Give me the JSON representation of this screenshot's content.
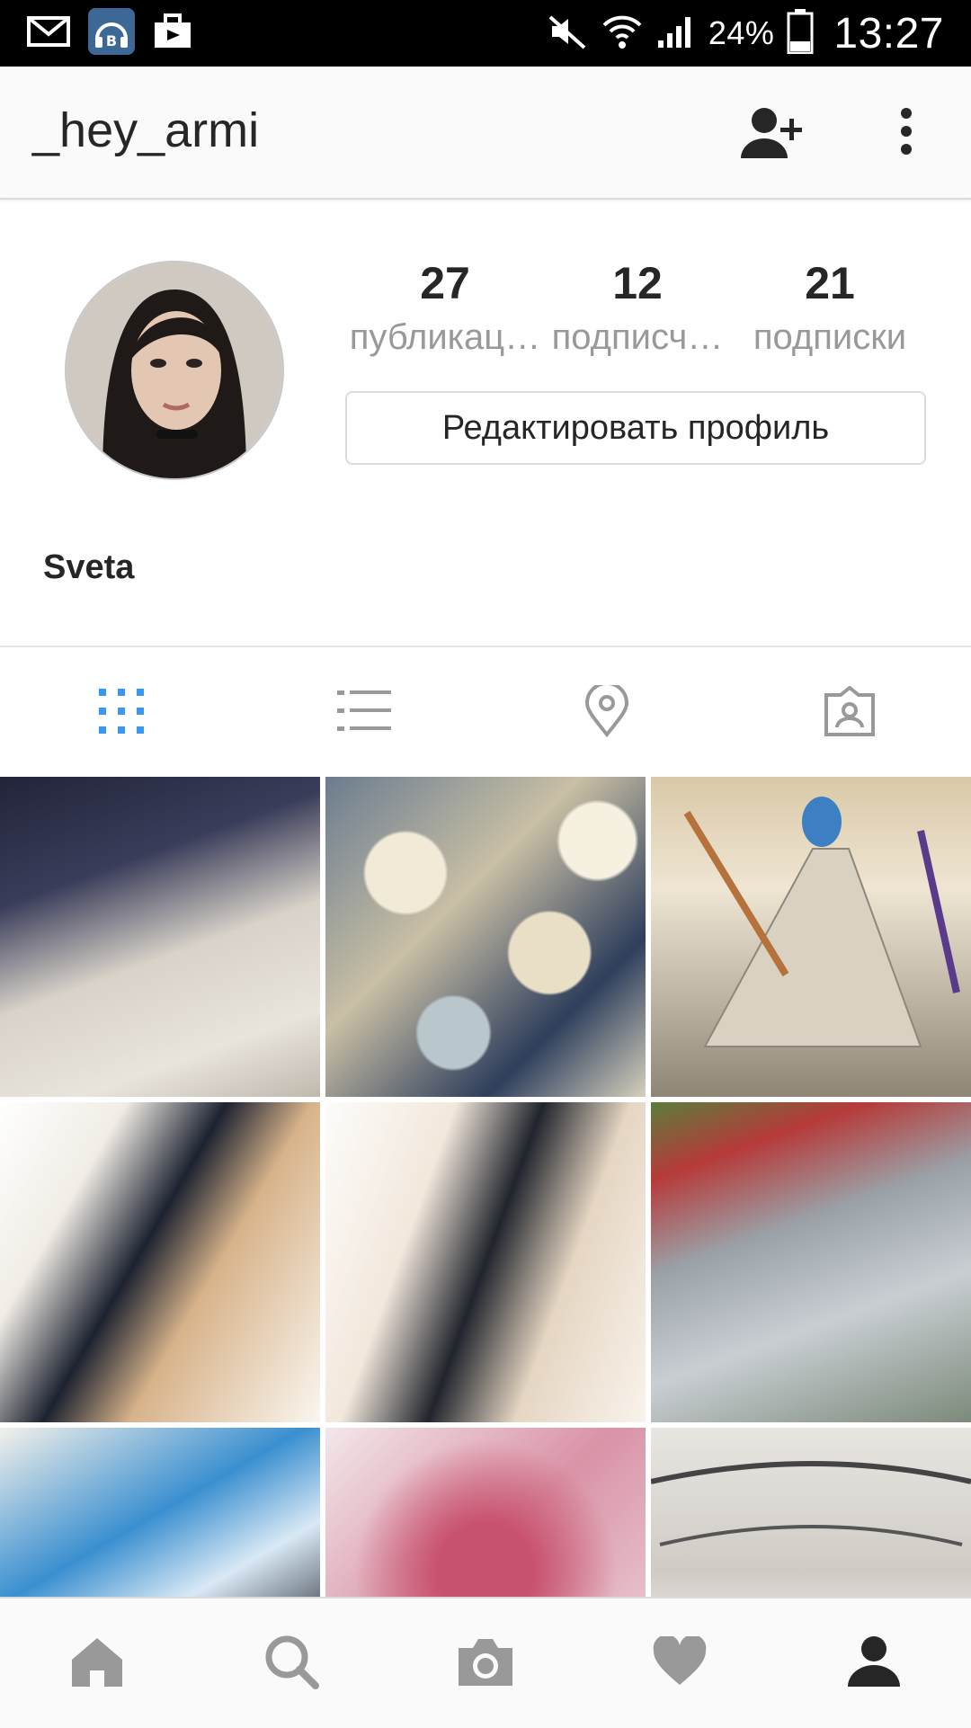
{
  "status_bar": {
    "battery_percent": "24%",
    "clock": "13:27",
    "icons": [
      "mail-icon",
      "vk-music-icon",
      "briefcase-icon",
      "mute-icon",
      "wifi-icon",
      "signal-icon",
      "battery-icon"
    ]
  },
  "header": {
    "username": "_hey_armi",
    "icons": [
      "add-person-icon",
      "overflow-menu-icon"
    ]
  },
  "profile": {
    "stats": [
      {
        "count": "27",
        "label": "публикац…"
      },
      {
        "count": "12",
        "label": "подписч…"
      },
      {
        "count": "21",
        "label": "подписки"
      }
    ],
    "edit_button_label": "Редактировать профиль",
    "display_name": "Sveta"
  },
  "view_tabs": [
    {
      "icon": "grid-icon",
      "active": true
    },
    {
      "icon": "list-icon",
      "active": false
    },
    {
      "icon": "location-pin-icon",
      "active": false
    },
    {
      "icon": "tagged-photos-icon",
      "active": false
    }
  ],
  "photo_grid": {
    "tiles": 9
  },
  "bottom_nav": [
    {
      "icon": "home-icon",
      "active": false
    },
    {
      "icon": "search-icon",
      "active": false
    },
    {
      "icon": "camera-icon",
      "active": false
    },
    {
      "icon": "heart-icon",
      "active": false
    },
    {
      "icon": "profile-icon",
      "active": true
    }
  ],
  "colors": {
    "active_tab": "#3897f0",
    "icon_inactive": "#999999",
    "icon_dark": "#262626"
  }
}
